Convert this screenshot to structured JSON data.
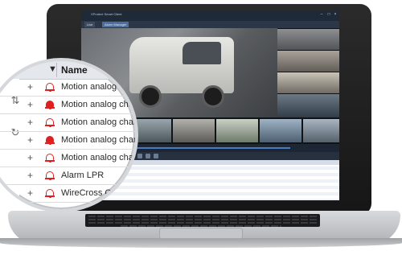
{
  "window": {
    "title": "XProtect Smart Client",
    "tabs": [
      {
        "label": "Live",
        "active": false
      },
      {
        "label": "Alarm Manager",
        "active": true
      }
    ]
  },
  "alarm_list": {
    "column_header": "Name",
    "rows": [
      {
        "name": "Motion analog cha",
        "alarm_icon": "bell-outline-icon"
      },
      {
        "name": "Motion analog channel",
        "alarm_icon": "bell-filled-icon"
      },
      {
        "name": "Motion analog channel",
        "alarm_icon": "bell-outline-icon"
      },
      {
        "name": "Motion analog channel",
        "alarm_icon": "bell-filled-icon"
      },
      {
        "name": "Motion analog channel",
        "alarm_icon": "bell-outline-icon"
      },
      {
        "name": "Alarm LPR",
        "alarm_icon": "bell-outline-icon"
      },
      {
        "name": "WireCross CamP",
        "alarm_icon": "bell-outline-icon"
      }
    ]
  },
  "colors": {
    "accent": "#2f6fb3",
    "alarm": "#e02020",
    "titlebar": "#1f2a38"
  }
}
